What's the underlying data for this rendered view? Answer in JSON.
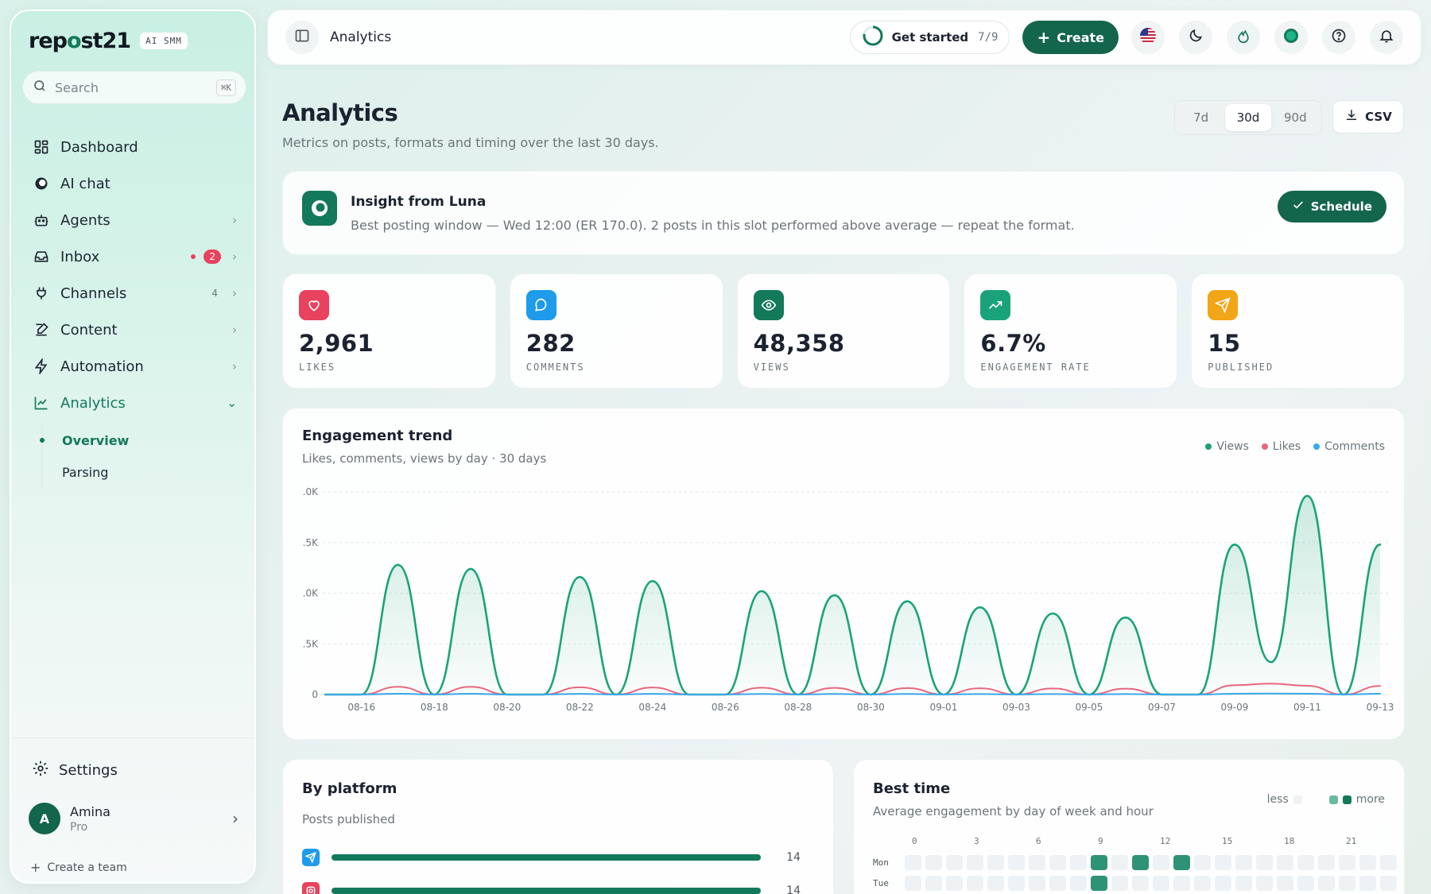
{
  "sidebar": {
    "logo_pre": "rep",
    "logo_o": "o",
    "logo_post": "st21",
    "logo_badge": "AI SMM",
    "search_placeholder": "Search",
    "search_shortcut": "⌘K",
    "items": [
      {
        "label": "Dashboard",
        "icon": "grid-icon"
      },
      {
        "label": "AI chat",
        "icon": "chat-circle-icon"
      },
      {
        "label": "Agents",
        "icon": "robot-icon"
      },
      {
        "label": "Inbox",
        "icon": "inbox-icon",
        "badge": "2"
      },
      {
        "label": "Channels",
        "icon": "plug-icon",
        "count": "4"
      },
      {
        "label": "Content",
        "icon": "edit-icon"
      },
      {
        "label": "Automation",
        "icon": "bolt-icon"
      },
      {
        "label": "Analytics",
        "icon": "chart-line-icon"
      }
    ],
    "analytics_sub": [
      "Overview",
      "Parsing"
    ],
    "settings_label": "Settings",
    "user_initial": "A",
    "user_name": "Amina",
    "user_plan": "Pro",
    "create_team_label": "Create a team"
  },
  "topbar": {
    "title": "Analytics",
    "get_started_label": "Get started",
    "get_started_count": "7/9",
    "create_label": "Create"
  },
  "header": {
    "title": "Analytics",
    "subtitle": "Metrics on posts, formats and timing over the last 30 days.",
    "ranges": [
      "7d",
      "30d",
      "90d"
    ],
    "active_range": "30d",
    "csv_label": "CSV"
  },
  "insight": {
    "title": "Insight from Luna",
    "text": "Best posting window — Wed 12:00 (ER 170.0). 2 posts in this slot performed above average — repeat the format.",
    "action_label": "Schedule"
  },
  "stats": [
    {
      "value": "2,961",
      "label": "LIKES",
      "color": "#e8425e",
      "icon": "heart-icon"
    },
    {
      "value": "282",
      "label": "COMMENTS",
      "color": "#1e9bea",
      "icon": "comment-icon"
    },
    {
      "value": "48,358",
      "label": "VIEWS",
      "color": "#13795b",
      "icon": "eye-icon"
    },
    {
      "value": "6.7%",
      "label": "ENGAGEMENT RATE",
      "color": "#1aa37a",
      "icon": "trend-up-icon"
    },
    {
      "value": "15",
      "label": "PUBLISHED",
      "color": "#f2a516",
      "icon": "send-icon"
    }
  ],
  "trend": {
    "title": "Engagement trend",
    "subtitle": "Likes, comments, views by day · 30 days",
    "legend": [
      "Views",
      "Likes",
      "Comments"
    ]
  },
  "chart_data": {
    "type": "area",
    "x": [
      "08-15",
      "08-16",
      "08-17",
      "08-18",
      "08-19",
      "08-20",
      "08-21",
      "08-22",
      "08-23",
      "08-24",
      "08-25",
      "08-26",
      "08-27",
      "08-28",
      "08-29",
      "08-30",
      "08-31",
      "09-01",
      "09-02",
      "09-03",
      "09-04",
      "09-05",
      "09-06",
      "09-07",
      "09-08",
      "09-09",
      "09-10",
      "09-11",
      "09-12",
      "09-13"
    ],
    "x_tick_labels": [
      "08-16",
      "08-18",
      "08-20",
      "08-22",
      "08-24",
      "08-26",
      "08-28",
      "08-30",
      "09-01",
      "09-03",
      "09-05",
      "09-07",
      "09-09",
      "09-11",
      "09-13"
    ],
    "y_tick_labels": [
      "0",
      ".5K",
      ".0K",
      ".5K",
      ".0K"
    ],
    "ylim": [
      0,
      10000
    ],
    "grid": true,
    "legend_position": "top-right",
    "series": [
      {
        "name": "Views",
        "color": "#1aa37a",
        "values": [
          0,
          0,
          6400,
          0,
          6200,
          0,
          0,
          5800,
          0,
          5600,
          0,
          0,
          5100,
          0,
          4900,
          0,
          4600,
          0,
          4300,
          0,
          4000,
          0,
          3800,
          0,
          0,
          7400,
          1600,
          9800,
          0,
          7400
        ]
      },
      {
        "name": "Likes",
        "color": "#e8677f",
        "values": [
          0,
          0,
          380,
          0,
          380,
          0,
          0,
          360,
          0,
          350,
          0,
          0,
          340,
          0,
          330,
          0,
          320,
          0,
          310,
          0,
          300,
          0,
          290,
          0,
          0,
          460,
          540,
          430,
          0,
          420
        ]
      },
      {
        "name": "Comments",
        "color": "#3aa7ea",
        "values": [
          0,
          0,
          40,
          0,
          40,
          0,
          0,
          35,
          0,
          35,
          0,
          0,
          30,
          0,
          30,
          0,
          30,
          0,
          25,
          0,
          25,
          0,
          25,
          0,
          0,
          40,
          50,
          40,
          0,
          40
        ]
      }
    ]
  },
  "platform": {
    "title": "By platform",
    "subtitle": "Posts published",
    "rows": [
      {
        "icon": "telegram-icon",
        "color": "#1e9bea",
        "value": "14",
        "fraction": 1.0
      },
      {
        "icon": "instagram-icon",
        "color": "#e8425e",
        "value": "14",
        "fraction": 1.0
      }
    ]
  },
  "best_time": {
    "title": "Best time",
    "subtitle": "Average engagement by day of week and hour",
    "legend_less": "less",
    "legend_more": "more",
    "hour_labels": [
      "0",
      "3",
      "6",
      "9",
      "12",
      "15",
      "18",
      "21"
    ],
    "days": [
      {
        "label": "Mon",
        "hot": [
          9,
          11,
          13
        ]
      },
      {
        "label": "Tue",
        "hot": [
          9
        ]
      }
    ]
  }
}
